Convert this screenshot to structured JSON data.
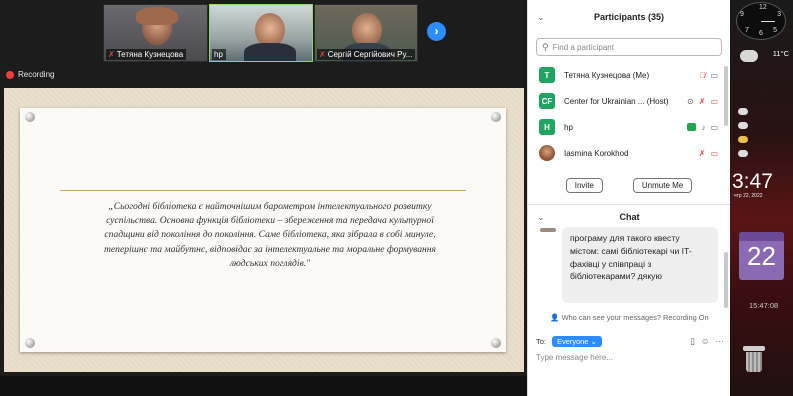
{
  "meeting": {
    "thumbnails": [
      {
        "name": "Тетяна Кузнецова",
        "mic": "muted"
      },
      {
        "name": "hp",
        "mic": "on",
        "active_speaker": true
      },
      {
        "name": "Сергій Сергійович Ру...",
        "mic": "muted"
      }
    ],
    "recording_label": "Recording",
    "slide_quote": "„Сьогодні бібліотека є найточнішим барометром інтелектуального розвитку суспільства. Основна функція бібліотеки – збереження та передача культурної спадщини від покоління до покоління. Саме бібліотека, яка зібрала в собі минуле, теперішнє та майбутнє, відповідає за інтелектуальне та моральне формування людських поглядів.\""
  },
  "participants": {
    "title": "Participants (35)",
    "search_placeholder": "Find a participant",
    "list": [
      {
        "initials": "T",
        "avatar_color": "#1fa463",
        "name": "Тетяна Кузнецова (Me)"
      },
      {
        "initials": "CF",
        "avatar_color": "#1fa463",
        "name": "Center for Ukrainian ... (Host)"
      },
      {
        "initials": "H",
        "avatar_color": "#1fa463",
        "name": "hp"
      },
      {
        "initials": "",
        "avatar_color": "#8a4b2f",
        "name": "Iasmina Korokhod"
      }
    ],
    "invite_label": "Invite",
    "unmute_label": "Unmute Me"
  },
  "chat": {
    "title": "Chat",
    "message": "програму для такого квесту містом: самі бібліотекарі чи IT-фахівці у співпраці з бібліотекарами? дякую",
    "who_can_see": "Who can see your messages? Recording On",
    "to_label": "To:",
    "recipient": "Everyone",
    "input_placeholder": "Type message here..."
  },
  "desktop": {
    "weather_temp": "11°C",
    "time": "3:47",
    "date": "чтр 22, 2022",
    "calendar_day": "22",
    "small_time": "15:47:08"
  },
  "colors": {
    "accent": "#2d8cff",
    "muted_red": "#e8413a",
    "avatar_green": "#1fa463"
  }
}
